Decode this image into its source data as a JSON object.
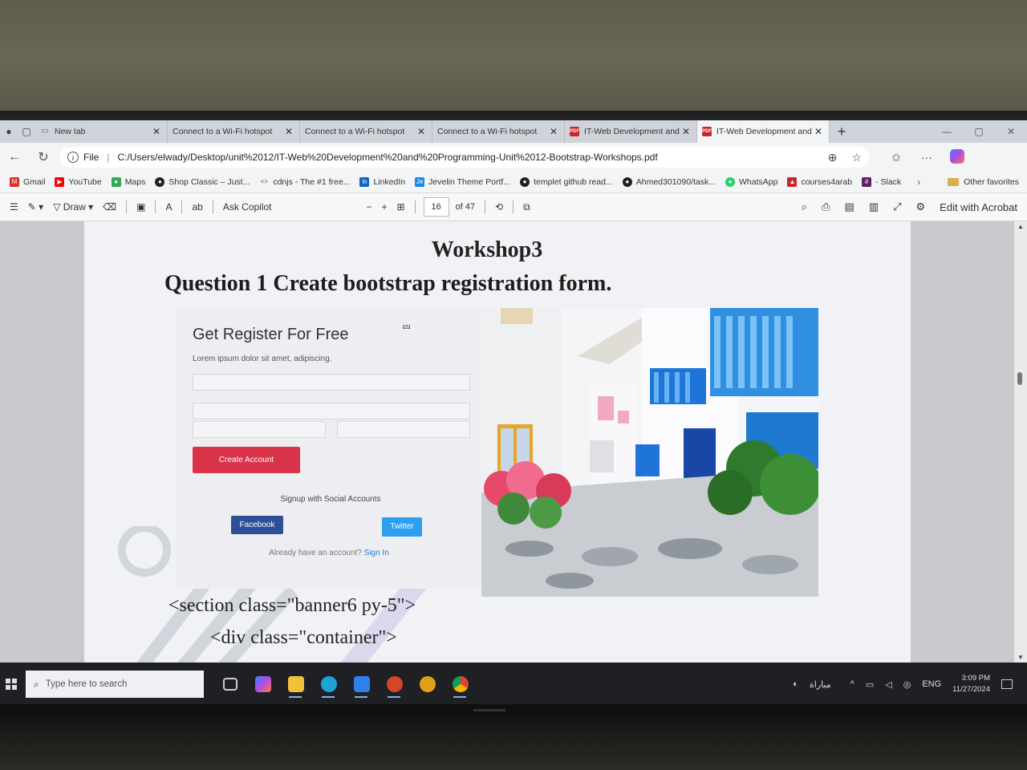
{
  "browser": {
    "tabs": [
      {
        "title": "New tab",
        "icon": "newtab-icon",
        "active": false
      },
      {
        "title": "Connect to a Wi-Fi hotspot",
        "icon": "page-icon",
        "active": false
      },
      {
        "title": "Connect to a Wi-Fi hotspot",
        "icon": "page-icon",
        "active": false
      },
      {
        "title": "Connect to a Wi-Fi hotspot",
        "icon": "page-icon",
        "active": false
      },
      {
        "title": "IT-Web Development and P",
        "icon": "pdf-icon",
        "active": false
      },
      {
        "title": "IT-Web Development and P",
        "icon": "pdf-icon",
        "active": true
      }
    ],
    "address": {
      "scheme": "File",
      "url": "C:/Users/elwady/Desktop/unit%2012/IT-Web%20Development%20and%20Programming-Unit%2012-Bootstrap-Workshops.pdf"
    },
    "bookmarks": [
      {
        "label": "Gmail",
        "color": "#d93025"
      },
      {
        "label": "YouTube",
        "color": "#ff0000"
      },
      {
        "label": "Maps",
        "color": "#34a853"
      },
      {
        "label": "Shop Classic – Just...",
        "color": "#222222"
      },
      {
        "label": "cdnjs - The #1 free...",
        "color": "#888888"
      },
      {
        "label": "LinkedIn",
        "color": "#0a66c2"
      },
      {
        "label": "Jevelin Theme Portf...",
        "color": "#1e88e5"
      },
      {
        "label": "templet github read...",
        "color": "#222222"
      },
      {
        "label": "Ahmed301090/task...",
        "color": "#222222"
      },
      {
        "label": "WhatsApp",
        "color": "#25d366"
      },
      {
        "label": "courses4arab",
        "color": "#c62828"
      },
      {
        "label": "- Slack",
        "color": "#611f69"
      }
    ],
    "other_favorites": "Other favorites"
  },
  "pdf_toolbar": {
    "draw": "Draw",
    "ask_copilot": "Ask Copilot",
    "page_current": "16",
    "page_total": "of 47",
    "edit_acrobat": "Edit with Acrobat"
  },
  "document": {
    "title": "Workshop3",
    "question": "Question 1 Create bootstrap registration form.",
    "form": {
      "heading": "Get Register For Free",
      "subtext": "Lorem ipsum dolor sit amet, adipiscing.",
      "create_button": "Create Account",
      "social_label": "Signup with Social Accounts",
      "facebook": "Facebook",
      "twitter": "Twitter",
      "already": "Already have an account?",
      "signin": "Sign In"
    },
    "code_line_1": "<section class=\"banner6 py-5\">",
    "code_line_2": "<div class=\"container\">"
  },
  "taskbar": {
    "search_placeholder": "Type here to search",
    "weather": "مباراة",
    "language": "ENG",
    "time": "3:09 PM",
    "date": "11/27/2024",
    "apps": [
      {
        "name": "task-view-icon",
        "color": "#cccccc"
      },
      {
        "name": "copilot-icon",
        "color": "#7b5cff"
      },
      {
        "name": "file-explorer-icon",
        "color": "#f0c23b"
      },
      {
        "name": "edge-icon",
        "color": "#1fa2d6"
      },
      {
        "name": "vscode-icon",
        "color": "#2f80ed"
      },
      {
        "name": "powerpoint-icon",
        "color": "#d24726"
      },
      {
        "name": "chrome-canary-icon",
        "color": "#e0a019"
      },
      {
        "name": "chrome-icon",
        "color": "#db4437"
      }
    ]
  }
}
